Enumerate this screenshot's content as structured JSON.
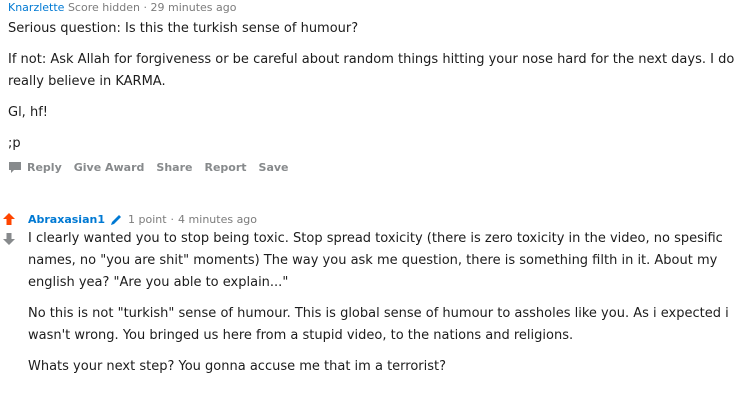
{
  "comment_top": {
    "username": "Knarzlette",
    "score": "Score hidden",
    "separator": "·",
    "time": "29 minutes ago",
    "paragraphs": [
      "Serious question: Is this the turkish sense of humour?",
      "If not: Ask Allah for forgiveness or be careful about random things hitting your nose hard for the next days. I do really believe in KARMA.",
      "Gl, hf!",
      ";p"
    ],
    "actions": {
      "reply": "Reply",
      "give_award": "Give Award",
      "share": "Share",
      "report": "Report",
      "save": "Save"
    }
  },
  "comment_reply": {
    "username": "Abraxasian1",
    "points": "1 point",
    "separator": "·",
    "time": "4 minutes ago",
    "paragraphs": [
      "I clearly wanted you to stop being toxic. Stop spread toxicity (there is zero toxicity in the video, no spesific names, no \"you are shit\" moments) The way you ask me question, there is something filth in it. About my english yea? \"Are you able to explain...\"",
      "No this is not \"turkish\" sense of humour. This is global sense of humour to assholes like you. As i expected i wasn't wrong. You bringed us here from a stupid video, to the nations and religions.",
      "Whats your next step? You gonna accuse me that im a terrorist?"
    ]
  },
  "colors": {
    "username": "#0079d3",
    "upvote": "#ff4500",
    "downvote": "#878a8c",
    "meta": "#7c7c7c",
    "actions": "#878a8c"
  },
  "icons": {
    "reply": "comment-bubble-icon",
    "upvote": "upvote-arrow-icon",
    "downvote": "downvote-arrow-icon",
    "edited": "pencil-icon"
  }
}
